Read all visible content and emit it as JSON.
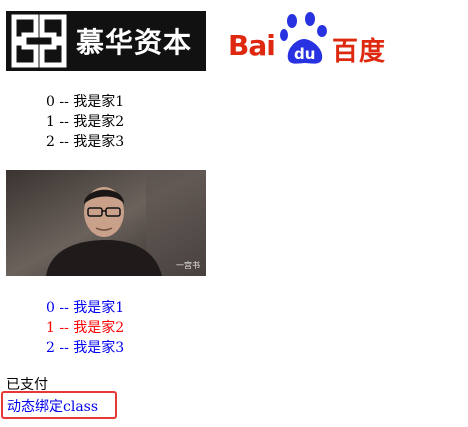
{
  "logos": {
    "imooc_text": "慕华资本",
    "baidu_bai": "Bai",
    "baidu_du": "du",
    "baidu_cn": "百度"
  },
  "list_static": [
    {
      "index": "0",
      "sep": " -- ",
      "text": "我是家1"
    },
    {
      "index": "1",
      "sep": " -- ",
      "text": "我是家2"
    },
    {
      "index": "2",
      "sep": " -- ",
      "text": "我是家3"
    }
  ],
  "photo": {
    "watermark": "一宫书"
  },
  "list_colored": [
    {
      "index": "0",
      "sep": " -- ",
      "text": "我是家1",
      "color": "#0000ee"
    },
    {
      "index": "1",
      "sep": " -- ",
      "text": "我是家2",
      "color": "#ff0000"
    },
    {
      "index": "2",
      "sep": " -- ",
      "text": "我是家3",
      "color": "#0000ee"
    }
  ],
  "status_text": "已支付",
  "dynamic_class_text": "动态绑定class",
  "colors": {
    "link_blue": "#0000ee",
    "active_red": "#ff0000",
    "highlight_border": "#e53935",
    "baidu_red": "#de2910",
    "baidu_blue": "#2932e1"
  }
}
